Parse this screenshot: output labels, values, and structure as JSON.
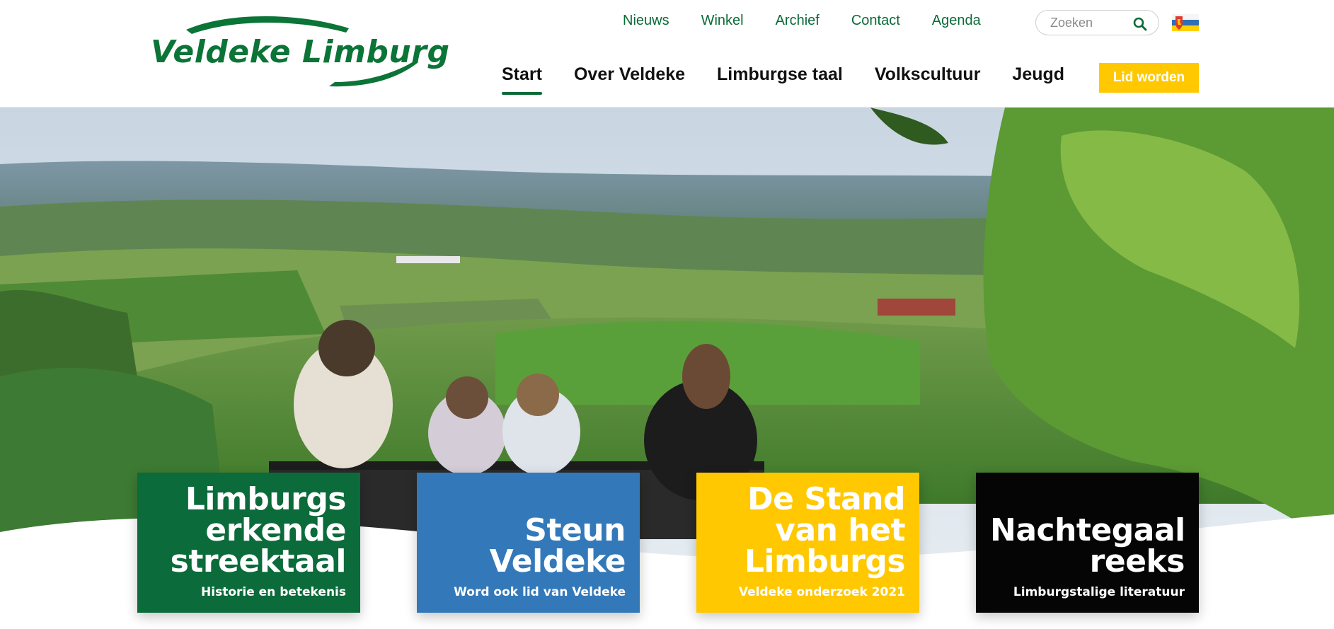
{
  "brand": {
    "name": "Veldeke Limburg",
    "primary_color": "#0b6b38",
    "accent_color": "#ffc800"
  },
  "topnav": {
    "items": [
      {
        "label": "Nieuws"
      },
      {
        "label": "Winkel"
      },
      {
        "label": "Archief"
      },
      {
        "label": "Contact"
      },
      {
        "label": "Agenda"
      }
    ]
  },
  "search": {
    "placeholder": "Zoeken",
    "icon": "search-icon"
  },
  "language": {
    "icon": "limburg-flag-icon"
  },
  "mainnav": {
    "items": [
      {
        "label": "Start",
        "active": true
      },
      {
        "label": "Over Veldeke",
        "active": false
      },
      {
        "label": "Limburgse taal",
        "active": false
      },
      {
        "label": "Volkscultuur",
        "active": false
      },
      {
        "label": "Jeugd",
        "active": false
      }
    ],
    "cta_label": "Lid worden"
  },
  "hero": {
    "image": "family-on-bench-overlooking-limburg-hills"
  },
  "cards": [
    {
      "title_lines": [
        "Limburgs",
        "erkende",
        "streektaal"
      ],
      "subtitle": "Historie en betekenis",
      "color": "#0b6b3a"
    },
    {
      "title_lines": [
        "Steun",
        "Veldeke"
      ],
      "subtitle": "Word ook lid van Veldeke",
      "color": "#3379ba"
    },
    {
      "title_lines": [
        "De Stand",
        "van het",
        "Limburgs"
      ],
      "subtitle": "Veldeke onderzoek 2021",
      "color": "#ffc800"
    },
    {
      "title_lines": [
        "Nachtegaal",
        "reeks"
      ],
      "subtitle": "Limburgstalige literatuur",
      "color": "#050505"
    }
  ]
}
